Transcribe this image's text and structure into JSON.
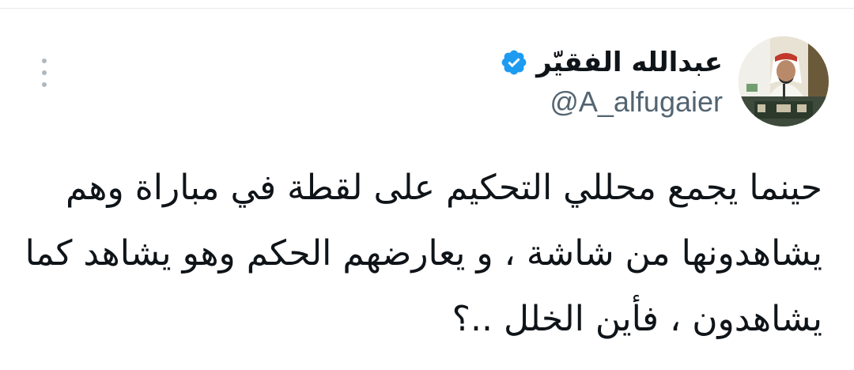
{
  "tweet": {
    "author": {
      "display_name": "عبدالله الفقيّر",
      "handle": "@A_alfugaier",
      "verified": true,
      "verified_icon": "verified-badge-icon",
      "avatar": "profile-photo"
    },
    "more_icon": "more-vertical-icon",
    "text_lines": [
      "حينما يجمع محللي التحكيم على لقطة في مباراة وهم",
      "يشاهدونها من شاشة ، و يعارضهم الحكم وهو يشاهد كما",
      "يشاهدون ، فأين الخلل ..؟"
    ]
  },
  "colors": {
    "text_primary": "#0f1419",
    "text_secondary": "#536471",
    "verified_blue": "#1d9bf0",
    "icon_gray": "#b0b8bf"
  }
}
